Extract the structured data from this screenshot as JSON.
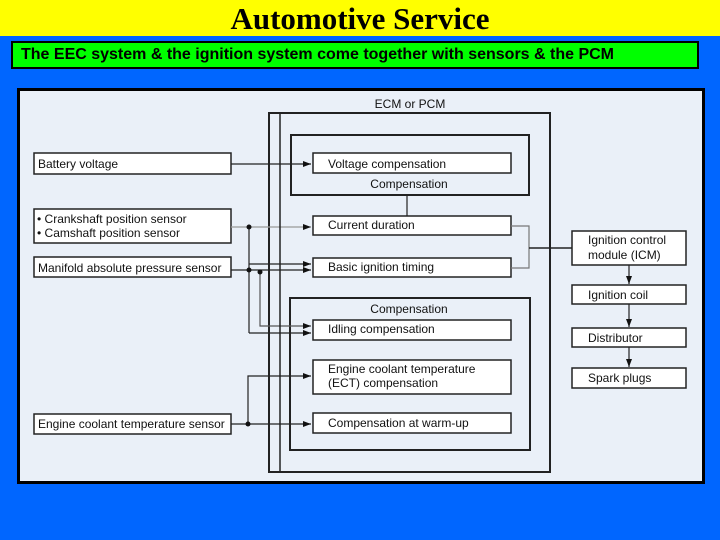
{
  "slide": {
    "title": "Automotive Service",
    "subtitle": "The EEC system & the ignition system come together with sensors & the PCM"
  },
  "diagram": {
    "module_title": "ECM or PCM",
    "inputs": {
      "battery": "Battery voltage",
      "crank": "• Crankshaft position sensor",
      "cam": "• Camshaft position sensor",
      "map": "Manifold absolute pressure sensor",
      "ect": "Engine coolant temperature sensor"
    },
    "upper_group_label": "Compensation",
    "lower_group_label": "Compensation",
    "blocks": {
      "voltage_comp": "Voltage compensation",
      "current_duration": "Current duration",
      "basic_timing": "Basic ignition timing",
      "idling_comp": "Idling compensation",
      "ect_comp_line1": "Engine coolant temperature",
      "ect_comp_line2": "(ECT) compensation",
      "warmup_comp": "Compensation at warm-up"
    },
    "outputs": {
      "icm_line1": "Ignition control",
      "icm_line2": "module (ICM)",
      "coil": "Ignition coil",
      "distributor": "Distributor",
      "spark_plugs": "Spark plugs"
    }
  }
}
